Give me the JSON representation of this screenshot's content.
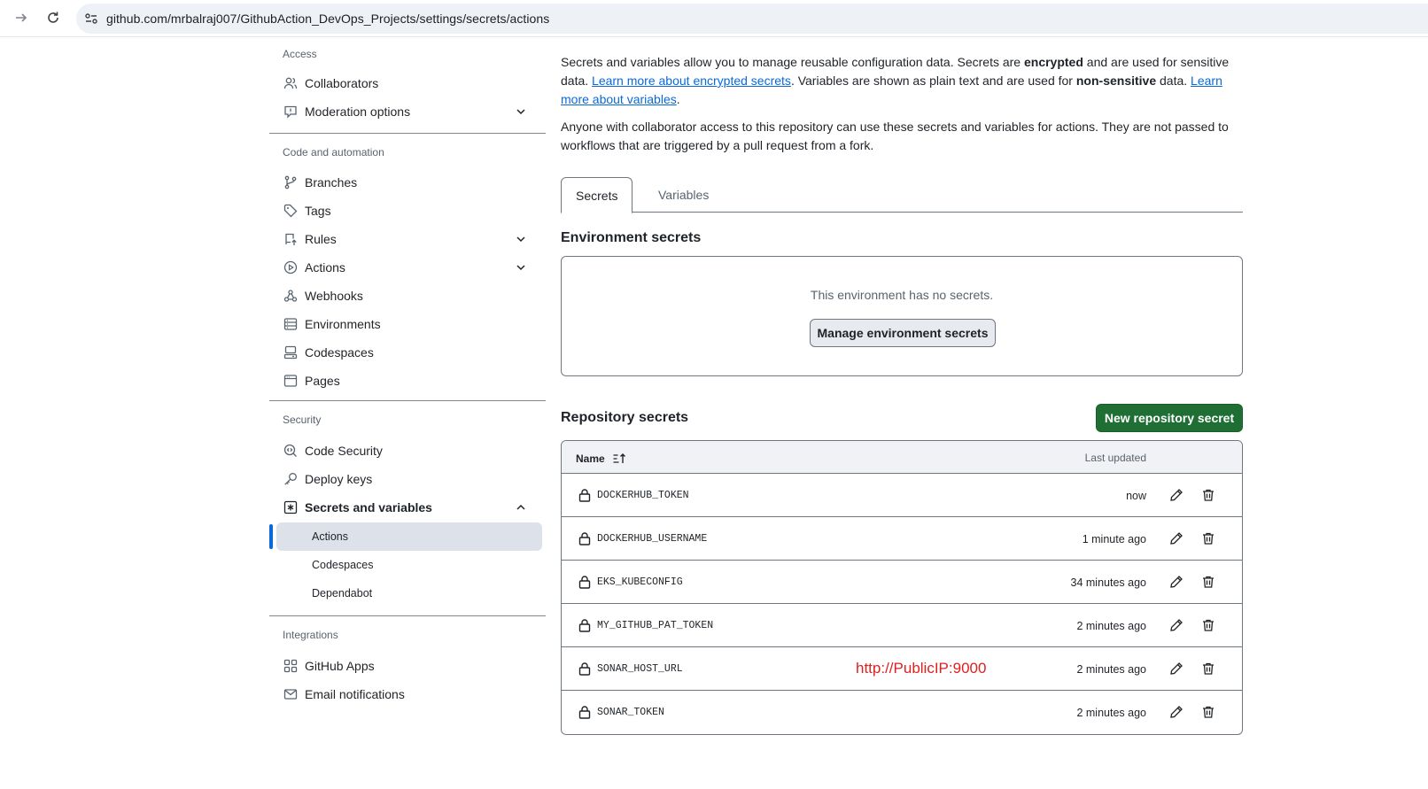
{
  "browser": {
    "url": "github.com/mrbalraj007/GithubAction_DevOps_Projects/settings/secrets/actions"
  },
  "sidebar": {
    "access_heading": "Access",
    "access_items": [
      {
        "label": "Collaborators",
        "icon": "people-icon"
      },
      {
        "label": "Moderation options",
        "icon": "report-icon",
        "expandable": true
      }
    ],
    "code_heading": "Code and automation",
    "code_items": [
      {
        "label": "Branches",
        "icon": "git-branch-icon"
      },
      {
        "label": "Tags",
        "icon": "tag-icon"
      },
      {
        "label": "Rules",
        "icon": "repo-push-icon",
        "expandable": true
      },
      {
        "label": "Actions",
        "icon": "play-icon",
        "expandable": true
      },
      {
        "label": "Webhooks",
        "icon": "webhook-icon"
      },
      {
        "label": "Environments",
        "icon": "server-icon"
      },
      {
        "label": "Codespaces",
        "icon": "codespaces-icon"
      },
      {
        "label": "Pages",
        "icon": "browser-icon"
      }
    ],
    "security_heading": "Security",
    "security_items": [
      {
        "label": "Code Security",
        "icon": "codescan-icon"
      },
      {
        "label": "Deploy keys",
        "icon": "key-icon"
      },
      {
        "label": "Secrets and variables",
        "icon": "key-asterisk-icon",
        "expanded": true
      }
    ],
    "secrets_subitems": [
      "Actions",
      "Codespaces",
      "Dependabot"
    ],
    "active_subitem": "Actions",
    "integrations_heading": "Integrations",
    "integration_items": [
      {
        "label": "GitHub Apps",
        "icon": "apps-icon"
      },
      {
        "label": "Email notifications",
        "icon": "mail-icon"
      }
    ]
  },
  "main": {
    "intro_p1": {
      "t1": "Secrets and variables allow you to manage reusable configuration data. Secrets are ",
      "b1": "encrypted",
      "t2": " and are used for sensitive data. ",
      "link1": "Learn more about encrypted secrets",
      "t3": ". Variables are shown as plain text and are used for ",
      "b2": "non-sensitive",
      "t4": " data. ",
      "link2": "Learn more about variables",
      "t5": "."
    },
    "intro_p2": "Anyone with collaborator access to this repository can use these secrets and variables for actions. They are not passed to workflows that are triggered by a pull request from a fork.",
    "tabs": [
      "Secrets",
      "Variables"
    ],
    "selected_tab": "Secrets",
    "env_title": "Environment secrets",
    "env_empty": "This environment has no secrets.",
    "env_button": "Manage environment secrets",
    "repo_title": "Repository secrets",
    "new_secret_button": "New repository secret",
    "table": {
      "col_name": "Name",
      "col_updated": "Last updated",
      "rows": [
        {
          "name": "DOCKERHUB_TOKEN",
          "updated": "now"
        },
        {
          "name": "DOCKERHUB_USERNAME",
          "updated": "1 minute ago"
        },
        {
          "name": "EKS_KUBECONFIG",
          "updated": "34 minutes ago"
        },
        {
          "name": "MY_GITHUB_PAT_TOKEN",
          "updated": "2 minutes ago"
        },
        {
          "name": "SONAR_HOST_URL",
          "updated": "2 minutes ago",
          "annotation": "http://PublicIP:9000"
        },
        {
          "name": "SONAR_TOKEN",
          "updated": "2 minutes ago"
        }
      ]
    }
  },
  "colors": {
    "accent": "#0969da",
    "primary_button": "#1f6f35",
    "annotation": "#e02020"
  }
}
